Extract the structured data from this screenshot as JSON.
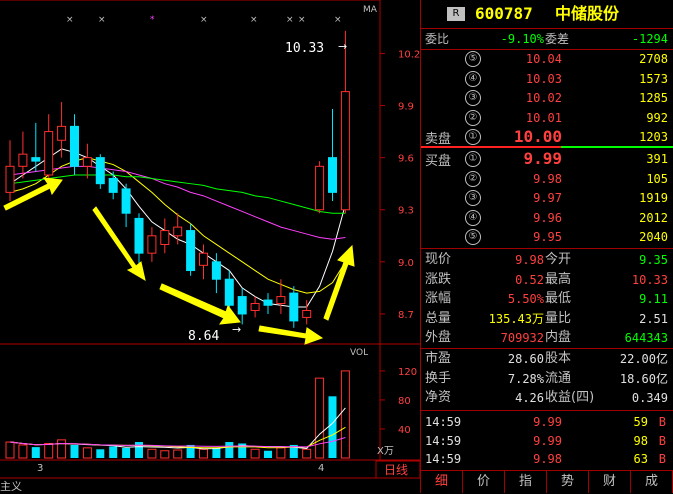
{
  "chart": {
    "ma_label": "MA",
    "vol_label": "VOL",
    "unit_label": "X万",
    "period_label": "日线",
    "left_bottom_label": "主义",
    "x_ticks": [
      "3",
      "4"
    ],
    "price_ticks": [
      "10.2",
      "9.9",
      "9.6",
      "9.3",
      "9.0",
      "8.7"
    ],
    "vol_ticks": [
      "120",
      "80",
      "40"
    ],
    "high_annot": "10.33",
    "low_annot": "8.64",
    "colors": {
      "up": "#ff3030",
      "down": "#00e5ff",
      "frame": "#b00000",
      "arrow": "#ffff00"
    }
  },
  "chart_data": {
    "type": "candlestick",
    "ylim": [
      8.55,
      10.45
    ],
    "candles": [
      {
        "o": 9.4,
        "c": 9.55,
        "h": 9.7,
        "l": 9.35
      },
      {
        "o": 9.55,
        "c": 9.62,
        "h": 9.75,
        "l": 9.48
      },
      {
        "o": 9.6,
        "c": 9.58,
        "h": 9.8,
        "l": 9.52
      },
      {
        "o": 9.5,
        "c": 9.75,
        "h": 9.85,
        "l": 9.48
      },
      {
        "o": 9.7,
        "c": 9.78,
        "h": 9.92,
        "l": 9.6
      },
      {
        "o": 9.78,
        "c": 9.55,
        "h": 9.85,
        "l": 9.5
      },
      {
        "o": 9.55,
        "c": 9.6,
        "h": 9.68,
        "l": 9.48
      },
      {
        "o": 9.6,
        "c": 9.45,
        "h": 9.62,
        "l": 9.42
      },
      {
        "o": 9.48,
        "c": 9.4,
        "h": 9.52,
        "l": 9.36
      },
      {
        "o": 9.42,
        "c": 9.28,
        "h": 9.45,
        "l": 9.2
      },
      {
        "o": 9.25,
        "c": 9.05,
        "h": 9.28,
        "l": 8.98
      },
      {
        "o": 9.05,
        "c": 9.15,
        "h": 9.2,
        "l": 9.0
      },
      {
        "o": 9.1,
        "c": 9.18,
        "h": 9.25,
        "l": 9.05
      },
      {
        "o": 9.15,
        "c": 9.2,
        "h": 9.28,
        "l": 9.1
      },
      {
        "o": 9.18,
        "c": 8.95,
        "h": 9.22,
        "l": 8.92
      },
      {
        "o": 8.98,
        "c": 9.05,
        "h": 9.1,
        "l": 8.9
      },
      {
        "o": 9.0,
        "c": 8.9,
        "h": 9.05,
        "l": 8.82
      },
      {
        "o": 8.9,
        "c": 8.75,
        "h": 8.95,
        "l": 8.7
      },
      {
        "o": 8.8,
        "c": 8.7,
        "h": 8.85,
        "l": 8.64
      },
      {
        "o": 8.72,
        "c": 8.76,
        "h": 8.8,
        "l": 8.68
      },
      {
        "o": 8.78,
        "c": 8.75,
        "h": 8.82,
        "l": 8.7
      },
      {
        "o": 8.76,
        "c": 8.8,
        "h": 8.9,
        "l": 8.7
      },
      {
        "o": 8.82,
        "c": 8.66,
        "h": 8.86,
        "l": 8.62
      },
      {
        "o": 8.68,
        "c": 8.72,
        "h": 8.78,
        "l": 8.64
      },
      {
        "o": 9.3,
        "c": 9.55,
        "h": 9.58,
        "l": 9.28
      },
      {
        "o": 9.6,
        "c": 9.4,
        "h": 9.88,
        "l": 9.35
      },
      {
        "o": 9.3,
        "c": 9.98,
        "h": 10.33,
        "l": 9.28
      }
    ],
    "volumes": [
      22,
      18,
      15,
      20,
      25,
      18,
      14,
      12,
      16,
      14,
      22,
      12,
      10,
      11,
      18,
      12,
      14,
      22,
      20,
      12,
      10,
      14,
      18,
      12,
      110,
      85,
      120
    ],
    "ma_lines": [
      {
        "name": "MA5",
        "color": "#ffffff",
        "values": [
          9.45,
          9.5,
          9.55,
          9.6,
          9.65,
          9.63,
          9.6,
          9.55,
          9.5,
          9.42,
          9.32,
          9.23,
          9.18,
          9.13,
          9.1,
          9.05,
          9.0,
          8.95,
          8.85,
          8.8,
          8.76,
          8.75,
          8.74,
          8.74,
          8.86,
          9.06,
          9.33
        ]
      },
      {
        "name": "MA10",
        "color": "#ffff00",
        "values": [
          9.4,
          9.42,
          9.45,
          9.5,
          9.55,
          9.58,
          9.6,
          9.58,
          9.56,
          9.52,
          9.46,
          9.4,
          9.33,
          9.27,
          9.22,
          9.15,
          9.1,
          9.05,
          9.0,
          8.95,
          8.9,
          8.87,
          8.84,
          8.82,
          8.83,
          8.88,
          9.0
        ]
      },
      {
        "name": "MA20",
        "color": "#ff40ff",
        "values": [
          9.5,
          9.51,
          9.52,
          9.53,
          9.54,
          9.55,
          9.55,
          9.54,
          9.53,
          9.52,
          9.5,
          9.48,
          9.45,
          9.43,
          9.4,
          9.38,
          9.35,
          9.32,
          9.29,
          9.26,
          9.23,
          9.2,
          9.18,
          9.16,
          9.14,
          9.13,
          9.14
        ]
      },
      {
        "name": "MA30",
        "color": "#00ff00",
        "values": [
          9.45,
          9.46,
          9.47,
          9.48,
          9.49,
          9.5,
          9.5,
          9.5,
          9.5,
          9.49,
          9.49,
          9.48,
          9.47,
          9.46,
          9.45,
          9.44,
          9.42,
          9.41,
          9.4,
          9.38,
          9.37,
          9.35,
          9.33,
          9.31,
          9.29,
          9.28,
          9.28
        ]
      }
    ]
  },
  "quote": {
    "badge": "R",
    "code": "600787",
    "name": "中储股份",
    "wei_bi_label": "委比",
    "wei_bi": "-9.10%",
    "wei_cha_label": "委差",
    "wei_cha": "-1294",
    "sell_label": "卖盘",
    "buy_label": "买盘",
    "asks": [
      {
        "n": "⑤",
        "price": "10.04",
        "vol": "2708"
      },
      {
        "n": "④",
        "price": "10.03",
        "vol": "1573"
      },
      {
        "n": "③",
        "price": "10.02",
        "vol": "1285"
      },
      {
        "n": "②",
        "price": "10.01",
        "vol": "992"
      },
      {
        "n": "①",
        "price": "10.00",
        "vol": "1203"
      }
    ],
    "bids": [
      {
        "n": "①",
        "price": "9.99",
        "vol": "391"
      },
      {
        "n": "②",
        "price": "9.98",
        "vol": "105"
      },
      {
        "n": "③",
        "price": "9.97",
        "vol": "1919"
      },
      {
        "n": "④",
        "price": "9.96",
        "vol": "2012"
      },
      {
        "n": "⑤",
        "price": "9.95",
        "vol": "2040"
      }
    ],
    "stats": [
      {
        "l1": "现价",
        "v1": "9.98",
        "c1": "red",
        "l2": "今开",
        "v2": "9.35",
        "c2": "grn"
      },
      {
        "l1": "涨跌",
        "v1": "0.52",
        "c1": "red",
        "l2": "最高",
        "v2": "10.33",
        "c2": "red"
      },
      {
        "l1": "涨幅",
        "v1": "5.50%",
        "c1": "red",
        "l2": "最低",
        "v2": "9.11",
        "c2": "grn"
      },
      {
        "l1": "总量",
        "v1": "135.43万",
        "c1": "yel",
        "l2": "量比",
        "v2": "2.51",
        "c2": "wht"
      },
      {
        "l1": "外盘",
        "v1": "709932",
        "c1": "red",
        "l2": "内盘",
        "v2": "644343",
        "c2": "grn"
      }
    ],
    "fund": [
      {
        "l1": "市盈",
        "v1": "28.60",
        "l2": "股本",
        "v2": "22.00亿"
      },
      {
        "l1": "换手",
        "v1": "7.28%",
        "l2": "流通",
        "v2": "18.60亿"
      },
      {
        "l1": "净资",
        "v1": "4.26",
        "l2": "收益(四)",
        "v2": "0.349"
      }
    ],
    "ticks": [
      {
        "t": "14:59",
        "p": "9.99",
        "v": "59",
        "s": "B"
      },
      {
        "t": "14:59",
        "p": "9.99",
        "v": "98",
        "s": "B"
      },
      {
        "t": "14:59",
        "p": "9.98",
        "v": "63",
        "s": "B"
      }
    ],
    "tabs": [
      "细",
      "价",
      "指",
      "势",
      "财",
      "成"
    ]
  }
}
